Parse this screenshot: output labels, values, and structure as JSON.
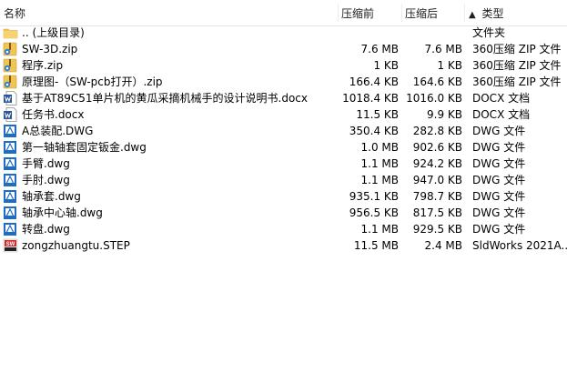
{
  "header": {
    "name": "名称",
    "packed": "压缩前",
    "size": "压缩后",
    "type": "类型",
    "sort_arrow": "▲"
  },
  "files": [
    {
      "name": ".. (上级目录)",
      "packed": "",
      "size": "",
      "type": "文件夹",
      "icon": "folder-up-icon"
    },
    {
      "name": "SW-3D.zip",
      "packed": "7.6 MB",
      "size": "7.6 MB",
      "type": "360压缩 ZIP 文件",
      "icon": "zip-archive-icon"
    },
    {
      "name": "程序.zip",
      "packed": "1 KB",
      "size": "1 KB",
      "type": "360压缩 ZIP 文件",
      "icon": "zip-archive-icon"
    },
    {
      "name": "原理图-（SW-pcb打开）.zip",
      "packed": "166.4 KB",
      "size": "164.6 KB",
      "type": "360压缩 ZIP 文件",
      "icon": "zip-archive-icon"
    },
    {
      "name": "基于AT89C51单片机的黄瓜采摘机械手的设计说明书.docx",
      "packed": "1018.4 KB",
      "size": "1016.0 KB",
      "type": "DOCX 文档",
      "icon": "docx-document-icon"
    },
    {
      "name": "任务书.docx",
      "packed": "11.5 KB",
      "size": "9.9 KB",
      "type": "DOCX 文档",
      "icon": "docx-document-icon"
    },
    {
      "name": "A总装配.DWG",
      "packed": "350.4 KB",
      "size": "282.8 KB",
      "type": "DWG 文件",
      "icon": "dwg-file-icon"
    },
    {
      "name": "第一轴轴套固定钣金.dwg",
      "packed": "1.0 MB",
      "size": "902.6 KB",
      "type": "DWG 文件",
      "icon": "dwg-file-icon"
    },
    {
      "name": "手臂.dwg",
      "packed": "1.1 MB",
      "size": "924.2 KB",
      "type": "DWG 文件",
      "icon": "dwg-file-icon"
    },
    {
      "name": "手肘.dwg",
      "packed": "1.1 MB",
      "size": "947.0 KB",
      "type": "DWG 文件",
      "icon": "dwg-file-icon"
    },
    {
      "name": "轴承套.dwg",
      "packed": "935.1 KB",
      "size": "798.7 KB",
      "type": "DWG 文件",
      "icon": "dwg-file-icon"
    },
    {
      "name": "轴承中心轴.dwg",
      "packed": "956.5 KB",
      "size": "817.5 KB",
      "type": "DWG 文件",
      "icon": "dwg-file-icon"
    },
    {
      "name": "转盘.dwg",
      "packed": "1.1 MB",
      "size": "929.5 KB",
      "type": "DWG 文件",
      "icon": "dwg-file-icon"
    },
    {
      "name": "zongzhuangtu.STEP",
      "packed": "11.5 MB",
      "size": "2.4 MB",
      "type": "SldWorks 2021A...",
      "icon": "step-solidworks-icon"
    }
  ],
  "colors": {
    "folder": "#f1c453",
    "zip_blue": "#2f7fd0",
    "docx_blue": "#2b5797",
    "dwg_blue": "#1e6bc8",
    "sw_red": "#d22a2a"
  }
}
